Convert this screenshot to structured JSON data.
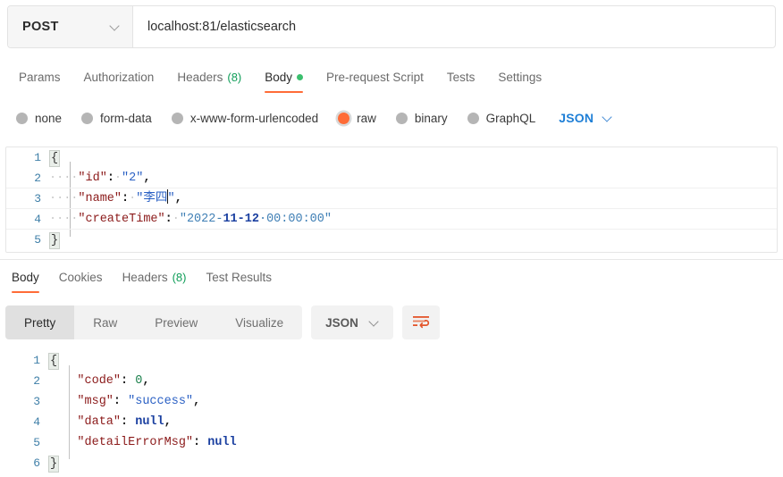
{
  "request": {
    "method": "POST",
    "method_icon": "chevron-down-icon",
    "url": "localhost:81/elasticsearch",
    "tabs": [
      {
        "label": "Params",
        "active": false
      },
      {
        "label": "Authorization",
        "active": false
      },
      {
        "label": "Headers",
        "count": "(8)",
        "active": false
      },
      {
        "label": "Body",
        "active": true,
        "dot": "green"
      },
      {
        "label": "Pre-request Script",
        "active": false
      },
      {
        "label": "Tests",
        "active": false
      },
      {
        "label": "Settings",
        "active": false
      }
    ],
    "body_types": [
      {
        "label": "none",
        "checked": false
      },
      {
        "label": "form-data",
        "checked": false
      },
      {
        "label": "x-www-form-urlencoded",
        "checked": false
      },
      {
        "label": "raw",
        "checked": true
      },
      {
        "label": "binary",
        "checked": false
      },
      {
        "label": "GraphQL",
        "checked": false
      }
    ],
    "format": "JSON",
    "format_icon": "chevron-down-icon",
    "code": {
      "lines": [
        "1",
        "2",
        "3",
        "4",
        "5"
      ],
      "l1_brace": "{",
      "l2_ws": "····",
      "l2_key": "\"id\"",
      "l2_colon": ":",
      "l2_sp": "·",
      "l2_val": "\"2\"",
      "l2_comma": ",",
      "l3_ws": "····",
      "l3_key": "\"name\"",
      "l3_colon": ":",
      "l3_sp": "·",
      "l3_val_open": "\"李四",
      "l3_val_close": "\"",
      "l3_comma": ",",
      "l4_ws": "····",
      "l4_key": "\"createTime\"",
      "l4_colon": ":",
      "l4_sp": "·",
      "l4_val_a": "\"2022-",
      "l4_val_b": "11-12",
      "l4_val_c": "·00:00:00\"",
      "l5_brace": "}"
    }
  },
  "response": {
    "tabs": [
      {
        "label": "Body",
        "active": true
      },
      {
        "label": "Cookies",
        "active": false
      },
      {
        "label": "Headers",
        "count": "(8)",
        "active": false
      },
      {
        "label": "Test Results",
        "active": false
      }
    ],
    "views": [
      {
        "label": "Pretty",
        "active": true
      },
      {
        "label": "Raw",
        "active": false
      },
      {
        "label": "Preview",
        "active": false
      },
      {
        "label": "Visualize",
        "active": false
      }
    ],
    "format": "JSON",
    "format_icon": "chevron-down-icon",
    "wrap_icon": "word-wrap-icon",
    "code": {
      "lines": [
        "1",
        "2",
        "3",
        "4",
        "5",
        "6"
      ],
      "l1_brace": "{",
      "l2_key": "    \"code\"",
      "l2_colon": ": ",
      "l2_val": "0",
      "l2_comma": ",",
      "l3_key": "    \"msg\"",
      "l3_colon": ": ",
      "l3_val": "\"success\"",
      "l3_comma": ",",
      "l4_key": "    \"data\"",
      "l4_colon": ": ",
      "l4_val": "null",
      "l4_comma": ",",
      "l5_key": "    \"detailErrorMsg\"",
      "l5_colon": ": ",
      "l5_val": "null",
      "l6_brace": "}"
    }
  },
  "colors": {
    "accent": "#ff6c37",
    "green": "#3bbf6e",
    "key": "#8b1a1a",
    "string": "#2a60c4",
    "number": "#1a7f4b",
    "keyword": "#1a3fa0",
    "link": "#1f7fd6"
  }
}
